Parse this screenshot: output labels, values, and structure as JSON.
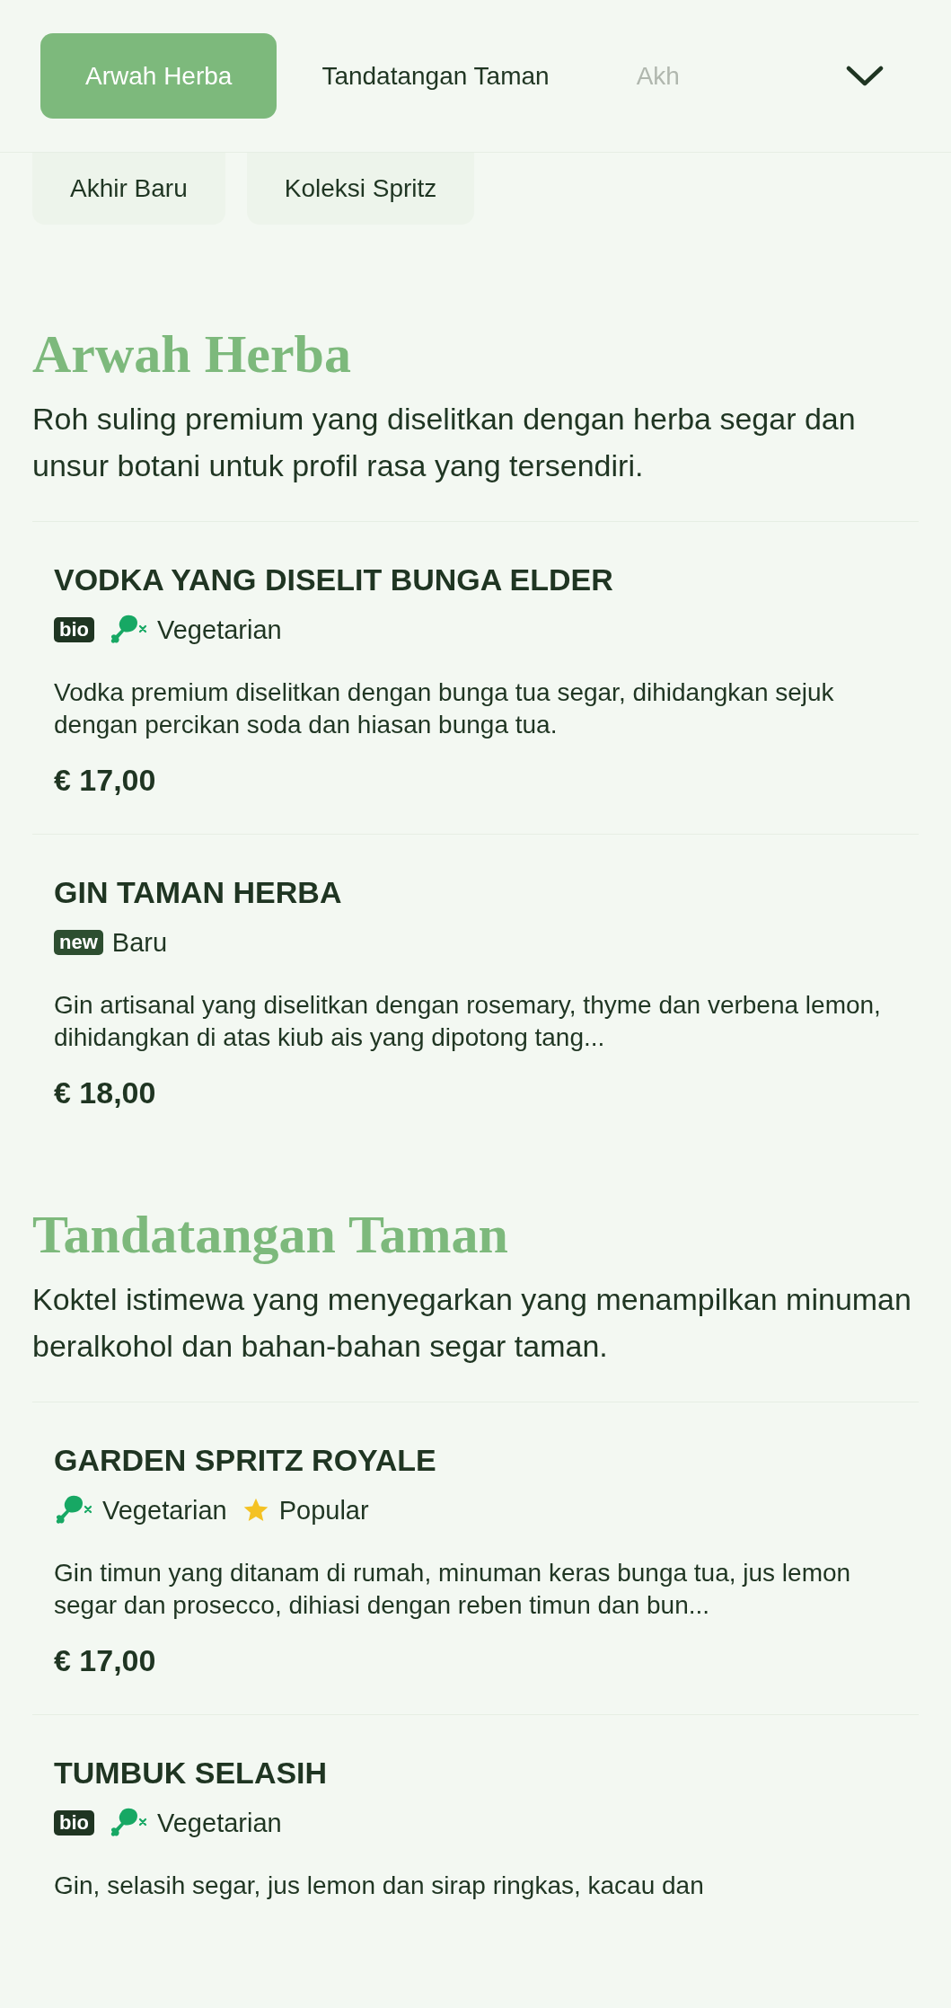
{
  "nav": {
    "tabs": [
      {
        "label": "Arwah Herba",
        "selected": true
      },
      {
        "label": "Tandatangan Taman",
        "selected": false
      },
      {
        "label": "Akh",
        "selected": false
      }
    ],
    "more_tabs": [
      {
        "label": "Akhir Baru",
        "selected": false
      },
      {
        "label": "Koleksi Spritz",
        "selected": false
      }
    ]
  },
  "sections": [
    {
      "title": "Arwah Herba",
      "description": "Roh suling premium yang diselitkan dengan herba segar dan unsur botani untuk profil rasa yang tersendiri.",
      "items": [
        {
          "name": "VODKA YANG DISELIT BUNGA ELDER",
          "tags": [
            {
              "kind": "badge",
              "badge": "bio"
            },
            {
              "kind": "vegetarian",
              "label": "Vegetarian"
            }
          ],
          "description": "Vodka premium diselitkan dengan bunga tua segar, dihidangkan sejuk dengan percikan soda dan hiasan bunga tua.",
          "price": "€ 17,00"
        },
        {
          "name": "GIN TAMAN HERBA",
          "tags": [
            {
              "kind": "badge",
              "badge": "new",
              "label": "Baru"
            }
          ],
          "description": "Gin artisanal yang diselitkan dengan rosemary, thyme dan verbena lemon, dihidangkan di atas kiub ais yang dipotong tang...",
          "price": "€ 18,00"
        }
      ]
    },
    {
      "title": "Tandatangan Taman",
      "description": "Koktel istimewa yang menyegarkan yang menampilkan minuman beralkohol dan bahan-bahan segar taman.",
      "items": [
        {
          "name": "GARDEN SPRITZ ROYALE",
          "tags": [
            {
              "kind": "vegetarian",
              "label": "Vegetarian"
            },
            {
              "kind": "popular",
              "label": "Popular"
            }
          ],
          "description": "Gin timun yang ditanam di rumah, minuman keras bunga tua, jus lemon segar dan prosecco, dihiasi dengan reben timun dan bun...",
          "price": "€ 17,00"
        },
        {
          "name": "TUMBUK SELASIH",
          "tags": [
            {
              "kind": "badge",
              "badge": "bio"
            },
            {
              "kind": "vegetarian",
              "label": "Vegetarian"
            }
          ],
          "description": "Gin, selasih segar, jus lemon dan sirap ringkas, kacau dan"
        }
      ]
    }
  ]
}
